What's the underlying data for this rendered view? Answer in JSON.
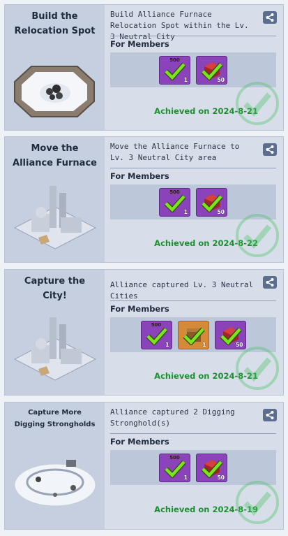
{
  "colors": {
    "achieved_text": "#1c8f2f",
    "stamp_green": "#3fbf5a",
    "check_green": "#7ce31d",
    "purple_item": "#8b43b9",
    "orange_item": "#d58a3a"
  },
  "tasks": [
    {
      "title": "Build the\nRelocation Spot",
      "description": "Build Alliance Furnace Relocation Spot within the Lv. 3 Neutral City",
      "members_label": "For Members",
      "rewards": [
        {
          "icon": "purple-chest-icon",
          "top_label": "500",
          "count": "1"
        },
        {
          "icon": "red-crate-icon",
          "top_label": "",
          "count": "50"
        }
      ],
      "achieved": "Achieved on 2024-8-21"
    },
    {
      "title": "Move the\nAlliance Furnace",
      "description": "Move the Alliance Furnace to Lv. 3 Neutral City area",
      "members_label": "For Members",
      "rewards": [
        {
          "icon": "purple-chest-icon",
          "top_label": "500",
          "count": "1"
        },
        {
          "icon": "red-crate-icon",
          "top_label": "",
          "count": "50"
        }
      ],
      "achieved": "Achieved on 2024-8-22"
    },
    {
      "title": "Capture the\nCity!",
      "description": "Alliance captured Lv. 3 Neutral Cities",
      "members_label": "For Members",
      "rewards": [
        {
          "icon": "purple-chest-icon",
          "top_label": "500",
          "count": "1"
        },
        {
          "icon": "orange-box-icon",
          "top_label": "",
          "count": "1"
        },
        {
          "icon": "red-crate-icon",
          "top_label": "",
          "count": "50"
        }
      ],
      "achieved": "Achieved on 2024-8-21"
    },
    {
      "title": "Capture More\nDigging Strongholds",
      "description": "Alliance captured 2 Digging Stronghold(s)",
      "members_label": "For Members",
      "rewards": [
        {
          "icon": "purple-chest-icon",
          "top_label": "500",
          "count": "1"
        },
        {
          "icon": "red-crate-icon",
          "top_label": "",
          "count": "50"
        }
      ],
      "achieved": "Achieved on 2024-8-19"
    }
  ]
}
